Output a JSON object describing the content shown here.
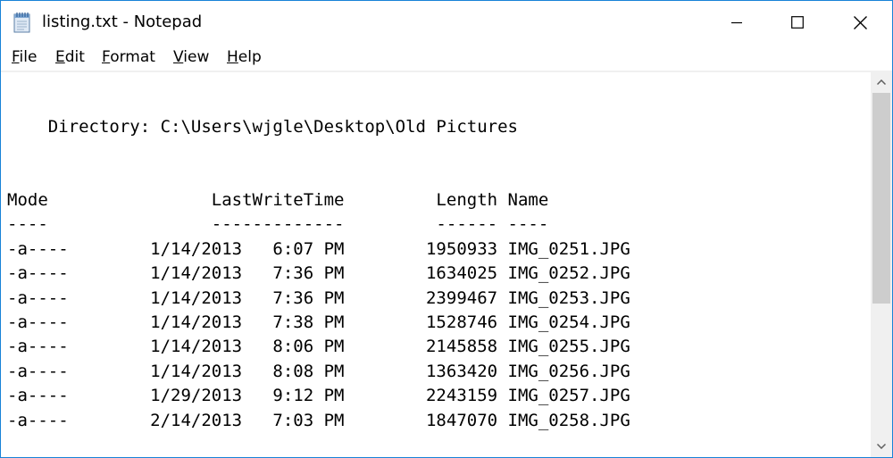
{
  "window": {
    "title": "listing.txt - Notepad",
    "accent_color": "#1883d7"
  },
  "icons": {
    "app": "notepad-icon",
    "minimize": "minimize-icon",
    "maximize": "maximize-icon",
    "close": "close-icon",
    "scroll_up": "chevron-up-icon",
    "scroll_down": "chevron-down-icon"
  },
  "menu": {
    "items": [
      {
        "label": "File",
        "accel": "F",
        "rest": "ile"
      },
      {
        "label": "Edit",
        "accel": "E",
        "rest": "dit"
      },
      {
        "label": "Format",
        "accel": "F",
        "rest": "ormat"
      },
      {
        "label": "View",
        "accel": "V",
        "rest": "iew"
      },
      {
        "label": "Help",
        "accel": "H",
        "rest": "elp"
      }
    ]
  },
  "document": {
    "lines": [
      "",
      "",
      "    Directory: C:\\Users\\wjgle\\Desktop\\Old Pictures",
      "",
      "",
      "Mode                LastWriteTime         Length Name",
      "----                -------------         ------ ----",
      "-a----        1/14/2013   6:07 PM        1950933 IMG_0251.JPG",
      "-a----        1/14/2013   7:36 PM        1634025 IMG_0252.JPG",
      "-a----        1/14/2013   7:36 PM        2399467 IMG_0253.JPG",
      "-a----        1/14/2013   7:38 PM        1528746 IMG_0254.JPG",
      "-a----        1/14/2013   8:06 PM        2145858 IMG_0255.JPG",
      "-a----        1/14/2013   8:08 PM        1363420 IMG_0256.JPG",
      "-a----        1/29/2013   9:12 PM        2243159 IMG_0257.JPG",
      "-a----        2/14/2013   7:03 PM        1847070 IMG_0258.JPG"
    ]
  }
}
